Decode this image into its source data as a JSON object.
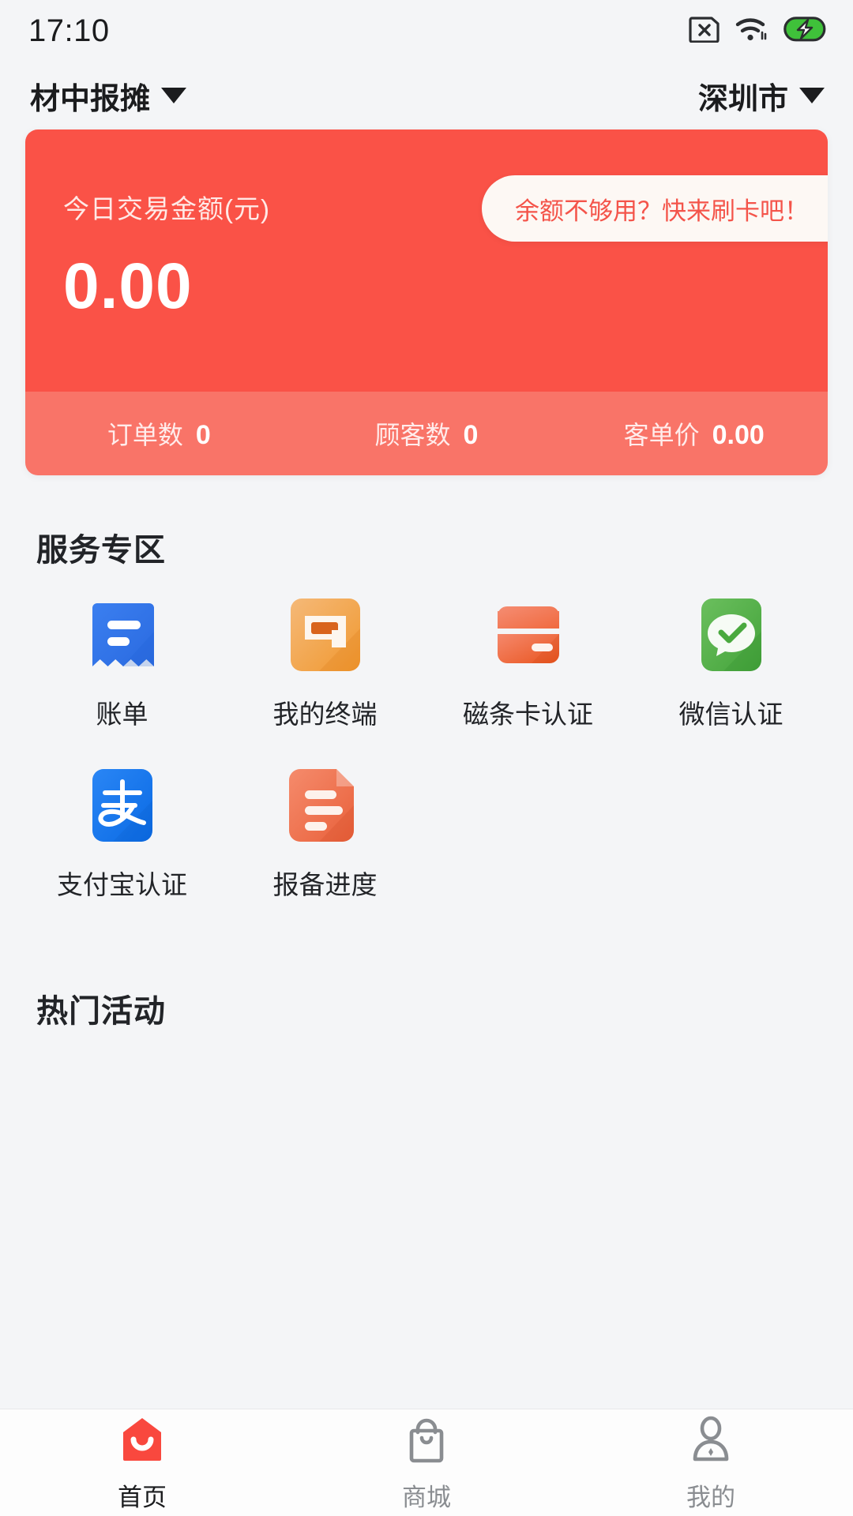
{
  "statusbar": {
    "time": "17:10",
    "icons": [
      {
        "name": "sim-card-off-icon"
      },
      {
        "name": "wifi-icon"
      },
      {
        "name": "battery-charging-icon"
      }
    ]
  },
  "header": {
    "merchant": "材中报摊",
    "merchant_caret": "merchant-dropdown-caret-icon",
    "city": "深圳市",
    "city_caret": "city-dropdown-caret-icon"
  },
  "summary_card": {
    "label": "今日交易金额(元)",
    "amount": "0.00",
    "promo_text": "余额不够用？快来刷卡吧！",
    "stats": [
      {
        "label": "订单数",
        "value": "0"
      },
      {
        "label": "顾客数",
        "value": "0"
      },
      {
        "label": "客单价",
        "value": "0.00"
      }
    ]
  },
  "service_section": {
    "title": "服务专区",
    "items": [
      {
        "label": "账单",
        "icon": "bill-receipt-icon"
      },
      {
        "label": "我的终端",
        "icon": "pos-terminal-icon"
      },
      {
        "label": "磁条卡认证",
        "icon": "magnetic-stripe-card-icon"
      },
      {
        "label": "微信认证",
        "icon": "wechat-verify-icon"
      },
      {
        "label": "支付宝认证",
        "icon": "alipay-verify-icon"
      },
      {
        "label": "报备进度",
        "icon": "filing-progress-document-icon"
      }
    ]
  },
  "hot_section": {
    "title": "热门活动"
  },
  "tabbar": {
    "tabs": [
      {
        "label": "首页",
        "icon": "home-icon",
        "active": true
      },
      {
        "label": "商城",
        "icon": "shop-bag-icon",
        "active": false
      },
      {
        "label": "我的",
        "icon": "profile-person-icon",
        "active": false
      }
    ]
  },
  "colors": {
    "brand_red": "#fa5247",
    "card_stats_red": "#f97468",
    "page_bg": "#f4f5f7",
    "battery_green": "#3fc13a"
  }
}
